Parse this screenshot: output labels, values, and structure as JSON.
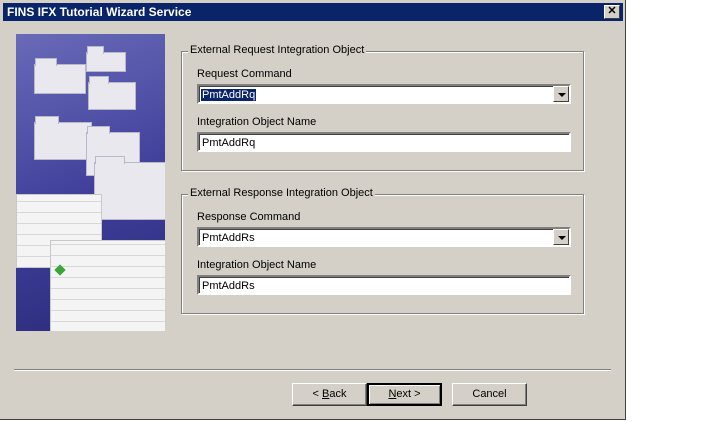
{
  "window": {
    "title": "FINS IFX Tutorial Wizard Service",
    "close_symbol": "✕"
  },
  "request_group": {
    "title": "External Request Integration Object",
    "command_label": "Request Command",
    "command_value": "PmtAddRq",
    "io_name_label": "Integration Object Name",
    "io_name_value": "PmtAddRq"
  },
  "response_group": {
    "title": "External Response Integration Object",
    "command_label": "Response Command",
    "command_value": "PmtAddRs",
    "io_name_label": "Integration Object Name",
    "io_name_value": "PmtAddRs"
  },
  "buttons": {
    "back_prefix": "< ",
    "back_accel": "B",
    "back_rest": "ack",
    "next_accel": "N",
    "next_rest": "ext >",
    "cancel": "Cancel"
  },
  "icons": {
    "dropdown": "chevron-down-icon",
    "close": "close-icon",
    "wizard_art": "folders-illustration"
  }
}
